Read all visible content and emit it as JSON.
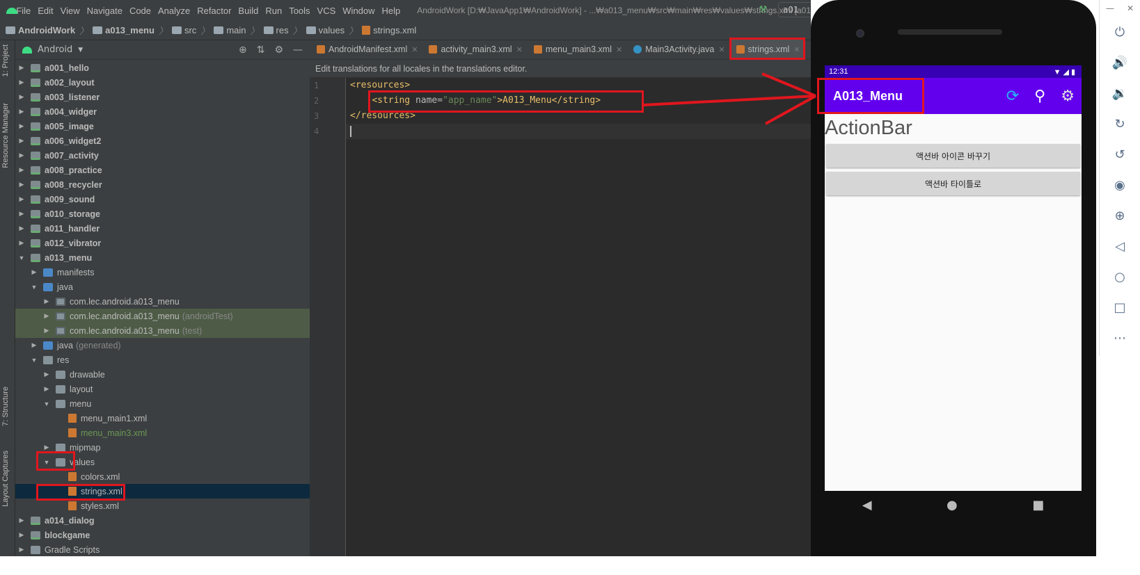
{
  "menubar": {
    "items": [
      "File",
      "Edit",
      "View",
      "Navigate",
      "Code",
      "Analyze",
      "Refactor",
      "Build",
      "Run",
      "Tools",
      "VCS",
      "Window",
      "Help"
    ],
    "title": "AndroidWork [D:₩JavaApp1₩AndroidWork] - ...₩a013_menu₩src₩main₩res₩values₩strings.xml [a01"
  },
  "breadcrumb": [
    "AndroidWork",
    "a013_menu",
    "src",
    "main",
    "res",
    "values",
    "strings.xml"
  ],
  "run_config": "a01",
  "left_strip": {
    "project": "1: Project",
    "resource_manager": "Resource Manager",
    "structure": "7: Structure",
    "layout_captures": "Layout Captures"
  },
  "project_panel": {
    "view": "Android"
  },
  "tree": [
    {
      "label": "a001_hello",
      "muted": ""
    },
    {
      "label": "a002_layout",
      "muted": ""
    },
    {
      "label": "a003_listener",
      "muted": ""
    },
    {
      "label": "a004_widger",
      "muted": ""
    },
    {
      "label": "a005_image",
      "muted": ""
    },
    {
      "label": "a006_widget2",
      "muted": ""
    },
    {
      "label": "a007_activity",
      "muted": ""
    },
    {
      "label": "a008_practice",
      "muted": ""
    },
    {
      "label": "a008_recycler",
      "muted": ""
    },
    {
      "label": "a009_sound",
      "muted": ""
    },
    {
      "label": "a010_storage",
      "muted": ""
    },
    {
      "label": "a011_handler",
      "muted": ""
    },
    {
      "label": "a012_vibrator",
      "muted": ""
    },
    {
      "label": "a013_menu",
      "muted": ""
    },
    {
      "label": "manifests",
      "muted": ""
    },
    {
      "label": "java",
      "muted": ""
    },
    {
      "label": "com.lec.android.a013_menu",
      "muted": ""
    },
    {
      "label": "com.lec.android.a013_menu",
      "muted": "(androidTest)"
    },
    {
      "label": "com.lec.android.a013_menu",
      "muted": "(test)"
    },
    {
      "label": "java",
      "muted": "(generated)"
    },
    {
      "label": "res",
      "muted": ""
    },
    {
      "label": "drawable",
      "muted": ""
    },
    {
      "label": "layout",
      "muted": ""
    },
    {
      "label": "menu",
      "muted": ""
    },
    {
      "label": "menu_main1.xml",
      "muted": ""
    },
    {
      "label": "menu_main3.xml",
      "muted": ""
    },
    {
      "label": "mipmap",
      "muted": ""
    },
    {
      "label": "values",
      "muted": ""
    },
    {
      "label": "colors.xml",
      "muted": ""
    },
    {
      "label": "strings.xml",
      "muted": ""
    },
    {
      "label": "styles.xml",
      "muted": ""
    },
    {
      "label": "a014_dialog",
      "muted": ""
    },
    {
      "label": "blockgame",
      "muted": ""
    },
    {
      "label": "Gradle Scripts",
      "muted": ""
    }
  ],
  "tabs": [
    "AndroidManifest.xml",
    "activity_main3.xml",
    "menu_main3.xml",
    "Main3Activity.java",
    "strings.xml"
  ],
  "banner": "Edit translations for all locales in the translations editor.",
  "line_numbers": [
    "1",
    "2",
    "3",
    "4"
  ],
  "code": {
    "open_tag": "<resources>",
    "string_open": "<string ",
    "attr_name": "name=",
    "attr_value": "\"app_name\"",
    "string_value": ">A013_Menu</string>",
    "close_tag": "</resources>"
  },
  "phone": {
    "time": "12:31",
    "status_icons": "▼◢▮",
    "app_title": "A013_Menu",
    "heading": "ActionBar",
    "button1": "액션바 아이콘 바꾸기",
    "button2": "액션바 타이틀로",
    "icons": {
      "refresh": "⟳",
      "search": "⚲",
      "settings": "⚙"
    },
    "nav": {
      "back": "◀",
      "home": "●",
      "recents": "■"
    }
  },
  "emulator_toolbar": {
    "minimize": "—",
    "close": "✕",
    "icons": [
      "⏻",
      "🔊",
      "🔉",
      "↻",
      "↺",
      "◉",
      "⊕",
      "◁",
      "○",
      "□",
      "⋯"
    ]
  },
  "colors": {
    "annotation": "#e0161e",
    "app_bar": "#6200ee",
    "status_bar": "#3700b3"
  }
}
